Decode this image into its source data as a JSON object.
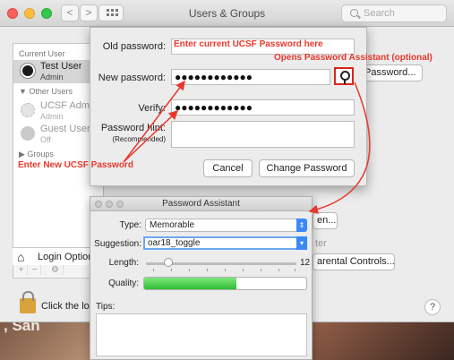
{
  "window": {
    "title": "Users & Groups",
    "search_placeholder": "Search",
    "nav_back": "<",
    "nav_fwd": ">"
  },
  "users": {
    "current_user_heading": "Current User",
    "current_user": {
      "name": "Test User",
      "role": "Admin"
    },
    "other_users_heading": "▼ Other Users",
    "other_users": [
      {
        "name": "UCSF Admin",
        "role": "Admin"
      },
      {
        "name": "Guest User",
        "role": "Off"
      }
    ],
    "groups_heading": "▶ Groups",
    "login_options": "Login Options",
    "plus": "+",
    "minus": "−",
    "gear": "⚙"
  },
  "background": {
    "change_password_btn": "Password...",
    "open_btn": "en...",
    "faded_text": "ter",
    "parental_controls_btn": "arental Controls...",
    "lock_text": "Click the lock",
    "help": "?",
    "desktop_text": ", San"
  },
  "change_password_sheet": {
    "old_password_label": "Old password:",
    "new_password_label": "New password:",
    "new_password_value": "●●●●●●●●●●●●",
    "verify_label": "Verify:",
    "verify_value": "●●●●●●●●●●●●",
    "hint_label": "Password hint:",
    "hint_sublabel": "(Recommended)",
    "cancel": "Cancel",
    "change_password": "Change Password"
  },
  "annotations": {
    "old_password_note": "Enter current UCSF Password here",
    "assistant_note": "Opens Password Assistant (optional)",
    "new_password_note": "Enter New UCSF Password",
    "color": "#e8372b"
  },
  "password_assistant": {
    "title": "Password Assistant",
    "type_label": "Type:",
    "type_value": "Memorable",
    "suggestion_label": "Suggestion:",
    "suggestion_value": "oar18_toggle",
    "length_label": "Length:",
    "length_value": "12",
    "length_fraction": 0.15,
    "quality_label": "Quality:",
    "quality_fraction": 0.57,
    "tips_label": "Tips:"
  }
}
